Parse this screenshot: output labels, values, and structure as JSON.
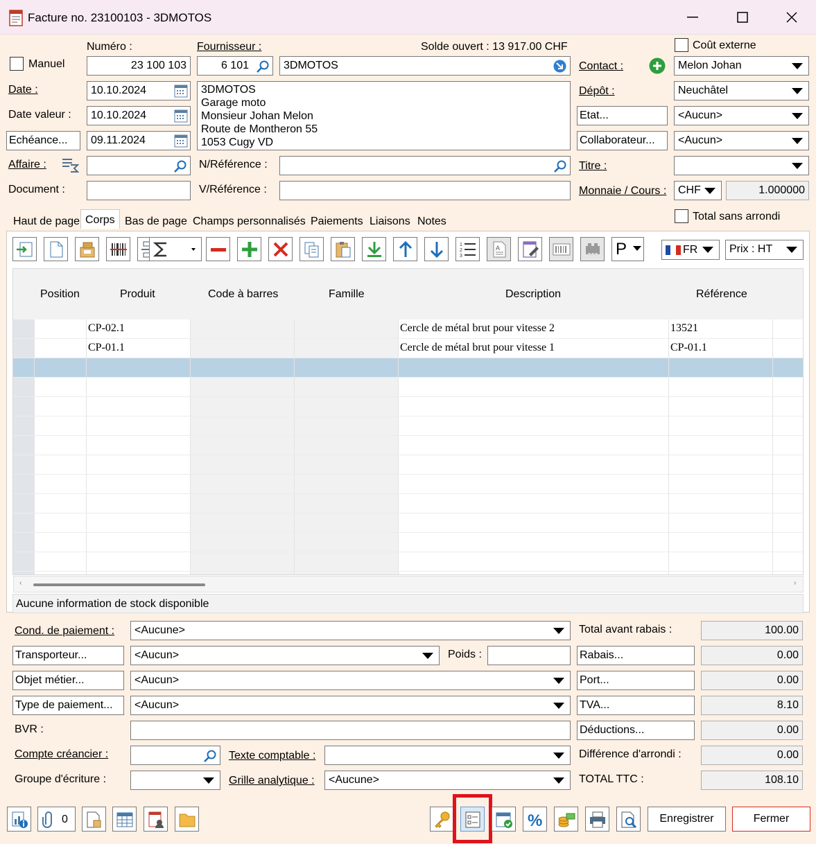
{
  "window": {
    "title": "Facture no. 23100103 - 3DMOTOS"
  },
  "header": {
    "manual_label": "Manuel",
    "numero_label": "Numéro :",
    "numero_value": "23 100 103",
    "fournisseur_label": "Fournisseur :",
    "fournisseur_code": "6 101",
    "fournisseur_name": "3DMOTOS",
    "solde_label": "Solde ouvert : 13 917.00 CHF",
    "cout_externe_label": "Coût externe",
    "date_label": "Date :",
    "date_value": "10.10.2024",
    "date_valeur_label": "Date valeur :",
    "date_valeur_value": "10.10.2024",
    "echeance_label": "Echéance...",
    "echeance_value": "09.11.2024",
    "address_lines": [
      "3DMOTOS",
      "Garage moto",
      "Monsieur Johan Melon",
      "Route de Montheron 55",
      "1053 Cugy VD"
    ],
    "affaire_label": "Affaire :",
    "nref_label": "N/Référence :",
    "document_label": "Document :",
    "vref_label": "V/Référence :",
    "contact_label": "Contact :",
    "contact_value": "Melon Johan",
    "depot_label": "Dépôt :",
    "depot_value": "Neuchâtel",
    "etat_label": "Etat...",
    "etat_value": "<Aucun>",
    "collab_label": "Collaborateur...",
    "collab_value": "<Aucun>",
    "titre_label": "Titre :",
    "titre_value": "",
    "monnaie_label": "Monnaie / Cours :",
    "monnaie_value": "CHF",
    "cours_value": "1.000000",
    "total_sans_arrondi_label": "Total sans arrondi"
  },
  "tabs": [
    "Haut de page",
    "Corps",
    "Bas de page",
    "Champs personnalisés",
    "Paiements",
    "Liaisons",
    "Notes"
  ],
  "toolbar": {
    "lang": "FR",
    "price": "Prix : HT",
    "p_label": "P"
  },
  "grid": {
    "columns": [
      "Position",
      "Produit",
      "Code à barres",
      "Famille",
      "Description",
      "Référence"
    ],
    "rows": [
      {
        "produit": "CP-02.1",
        "description": "Cercle de métal brut pour vitesse 2",
        "reference": "13521"
      },
      {
        "produit": "CP-01.1",
        "description": "Cercle de métal brut pour vitesse 1",
        "reference": "CP-01.1"
      }
    ]
  },
  "stock_info": "Aucune information de stock disponible",
  "footer": {
    "cond_label": "Cond. de paiement :",
    "cond_value": "<Aucune>",
    "transp_label": "Transporteur...",
    "transp_value": "<Aucun>",
    "poids_label": "Poids :",
    "objet_label": "Objet métier...",
    "objet_value": "<Aucun>",
    "typepay_label": "Type de paiement...",
    "typepay_value": "<Aucun>",
    "bvr_label": "BVR :",
    "compte_label": "Compte créancier :",
    "texte_label": "Texte comptable :",
    "groupe_label": "Groupe d'écriture :",
    "grille_label": "Grille analytique :",
    "grille_value": "<Aucune>",
    "total_avant_label": "Total avant rabais :",
    "total_avant": "100.00",
    "rabais_label": "Rabais...",
    "rabais": "0.00",
    "port_label": "Port...",
    "port": "0.00",
    "tva_label": "TVA...",
    "tva": "8.10",
    "deductions_label": "Déductions...",
    "deductions": "0.00",
    "diff_label": "Différence d'arrondi :",
    "diff": "0.00",
    "ttc_label": "TOTAL TTC :",
    "ttc": "108.10"
  },
  "bottom": {
    "attach_count": "0",
    "save_label": "Enregistrer",
    "close_label": "Fermer"
  },
  "colors": {
    "background": "#fdf0e4",
    "titlebar": "#f7eaf3",
    "selected_row": "#b8d2e3",
    "highlight": "#e0121a",
    "green": "#2e9e3e",
    "blue": "#1e6fb8",
    "red": "#d62b1f"
  }
}
